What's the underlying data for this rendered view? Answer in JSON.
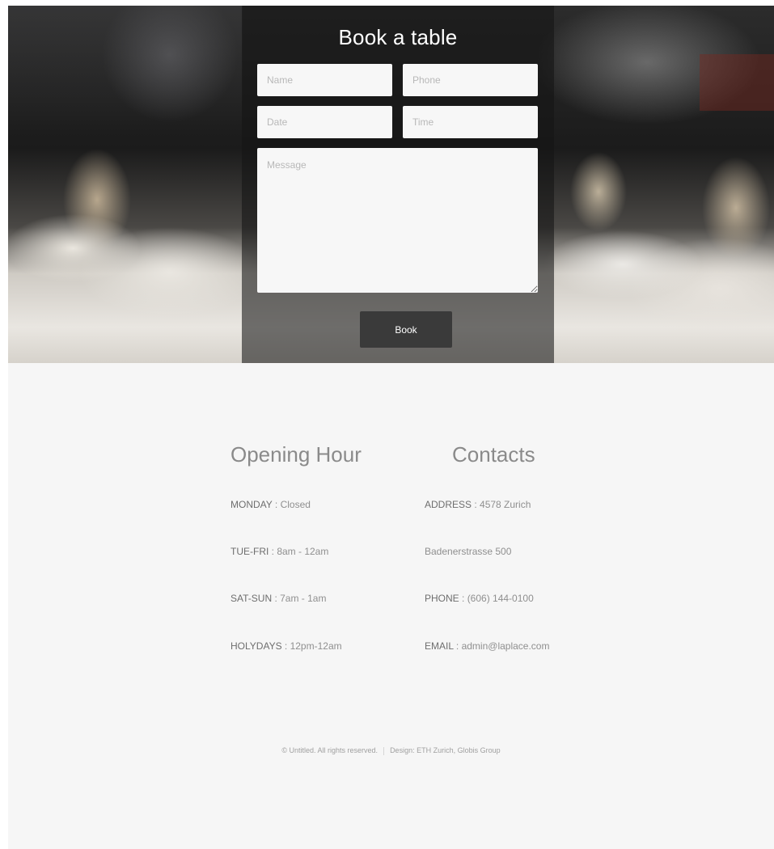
{
  "booking": {
    "title": "Book a table",
    "name_placeholder": "Name",
    "phone_placeholder": "Phone",
    "date_placeholder": "Date",
    "time_placeholder": "Time",
    "message_placeholder": "Message",
    "submit_label": "Book"
  },
  "hours": {
    "title": "Opening Hour",
    "rows": [
      {
        "key": "MONDAY",
        "value": " : Closed"
      },
      {
        "key": "TUE-FRI",
        "value": " : 8am - 12am"
      },
      {
        "key": "SAT-SUN",
        "value": " : 7am - 1am"
      },
      {
        "key": "HOLYDAYS",
        "value": " : 12pm-12am"
      }
    ]
  },
  "contacts": {
    "title": "Contacts",
    "rows": [
      {
        "key": "ADDRESS",
        "value": " : 4578 Zurich"
      },
      {
        "key": "",
        "value": "Badenerstrasse 500"
      },
      {
        "key": "PHONE",
        "value": " : (606) 144-0100"
      },
      {
        "key": "EMAIL",
        "value": " : admin@laplace.com"
      }
    ]
  },
  "footer": {
    "copyright": "© Untitled. All rights reserved.",
    "design": "Design: ETH Zurich, Globis Group"
  },
  "colors": {
    "overlay": "#141414",
    "button": "#3a3a3a",
    "page_bg": "#f6f6f6"
  }
}
